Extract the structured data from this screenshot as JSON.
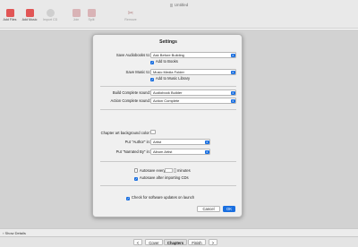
{
  "window": {
    "title": "Untitled"
  },
  "toolbar": {
    "items": [
      {
        "label": "Add Files",
        "icon": "add-files-icon",
        "color": "#e15656"
      },
      {
        "label": "Add Music",
        "icon": "add-music-icon",
        "color": "#e15656"
      },
      {
        "label": "Import CD",
        "icon": "cd-icon",
        "color": "#c7c7c7"
      },
      {
        "label": "Join",
        "icon": "join-icon",
        "color": "#d2a2a6"
      },
      {
        "label": "Split",
        "icon": "split-icon",
        "color": "#d2a2a6"
      },
      {
        "label": "Remove",
        "icon": "scissors-icon",
        "color": "#c9b1b1"
      }
    ]
  },
  "settings": {
    "title": "Settings",
    "save_audiobooks_label": "Save Audiobooks to:",
    "save_audiobooks_value": "Ask Before Building",
    "add_to_books_label": "Add to Books",
    "add_to_books_checked": true,
    "save_music_label": "Save Music to:",
    "save_music_value": "Music Media Folder",
    "add_to_music_label": "Add to Music Library",
    "add_to_music_checked": true,
    "build_sound_label": "Build Complete sound:",
    "build_sound_value": "Audiobook Builder",
    "action_sound_label": "Action Complete sound:",
    "action_sound_value": "Action Complete",
    "chapter_art_label": "Chapter art background color:",
    "chapter_art_color": "#ffffff",
    "author_label": "Put \"Author\" in:",
    "author_value": "Artist",
    "narrated_label": "Put \"Narrated By\" in:",
    "narrated_value": "Album Artist",
    "autosave_every_label": "Autosave every",
    "autosave_every_checked": false,
    "autosave_minutes_label": "minutes",
    "autosave_after_cd_label": "Autosave after importing CDs",
    "autosave_after_cd_checked": true,
    "check_updates_label": "Check for software updates on launch",
    "check_updates_checked": true,
    "cancel_label": "Cancel",
    "ok_label": "OK",
    "accent_color": "#1a6fe0"
  },
  "status": {
    "show_details_label": "Show Details"
  },
  "bottom_nav": {
    "prev": "<",
    "tabs": [
      "Cover",
      "Chapters",
      "Finish"
    ],
    "active": "Chapters",
    "next": ">"
  }
}
